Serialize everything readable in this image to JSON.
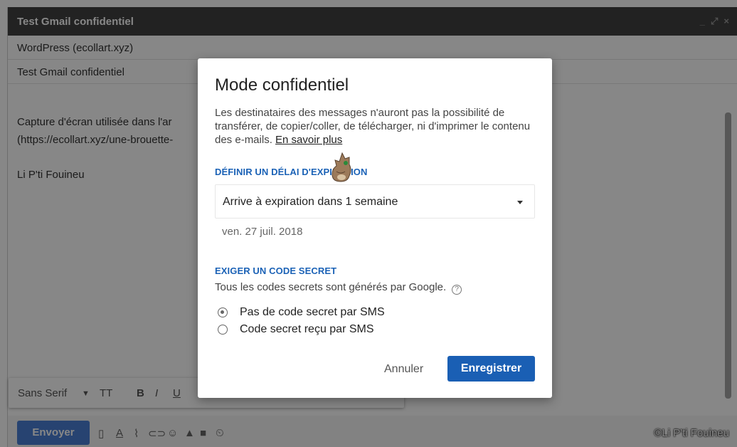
{
  "compose": {
    "window_title": "Test Gmail confidentiel",
    "recipients": "WordPress (ecollart.xyz)",
    "subject": "Test Gmail confidentiel",
    "body_line1": "Capture d'écran utilisée dans l'ar",
    "body_line2": "(https://ecollart.xyz/une-brouette-",
    "signature": "Li P'ti Fouineu"
  },
  "format_toolbar": {
    "font": "Sans Serif"
  },
  "bottom_bar": {
    "send_label": "Envoyer",
    "watermark": "©Li P'ti Fouineu"
  },
  "dialog": {
    "title": "Mode confidentiel",
    "description": "Les destinataires des messages n'auront pas la possibilité de transférer, de copier/coller, de télécharger, ni d'imprimer le contenu des e-mails.",
    "learn_more": "En savoir plus",
    "expiration_section": "DÉFINIR UN DÉLAI D'EXPIRATION",
    "expiration_value": "Arrive à expiration dans 1 semaine",
    "expiration_date": "ven. 27 juil. 2018",
    "passcode_section": "EXIGER UN CODE SECRET",
    "passcode_hint": "Tous les codes secrets sont générés par Google.",
    "options": [
      {
        "label": "Pas de code secret par SMS",
        "selected": true
      },
      {
        "label": "Code secret reçu par SMS",
        "selected": false
      }
    ],
    "cancel_label": "Annuler",
    "save_label": "Enregistrer"
  },
  "colors": {
    "accent": "#1a5fb4",
    "titlebar": "#404040",
    "send_button": "#4a7fd6"
  }
}
